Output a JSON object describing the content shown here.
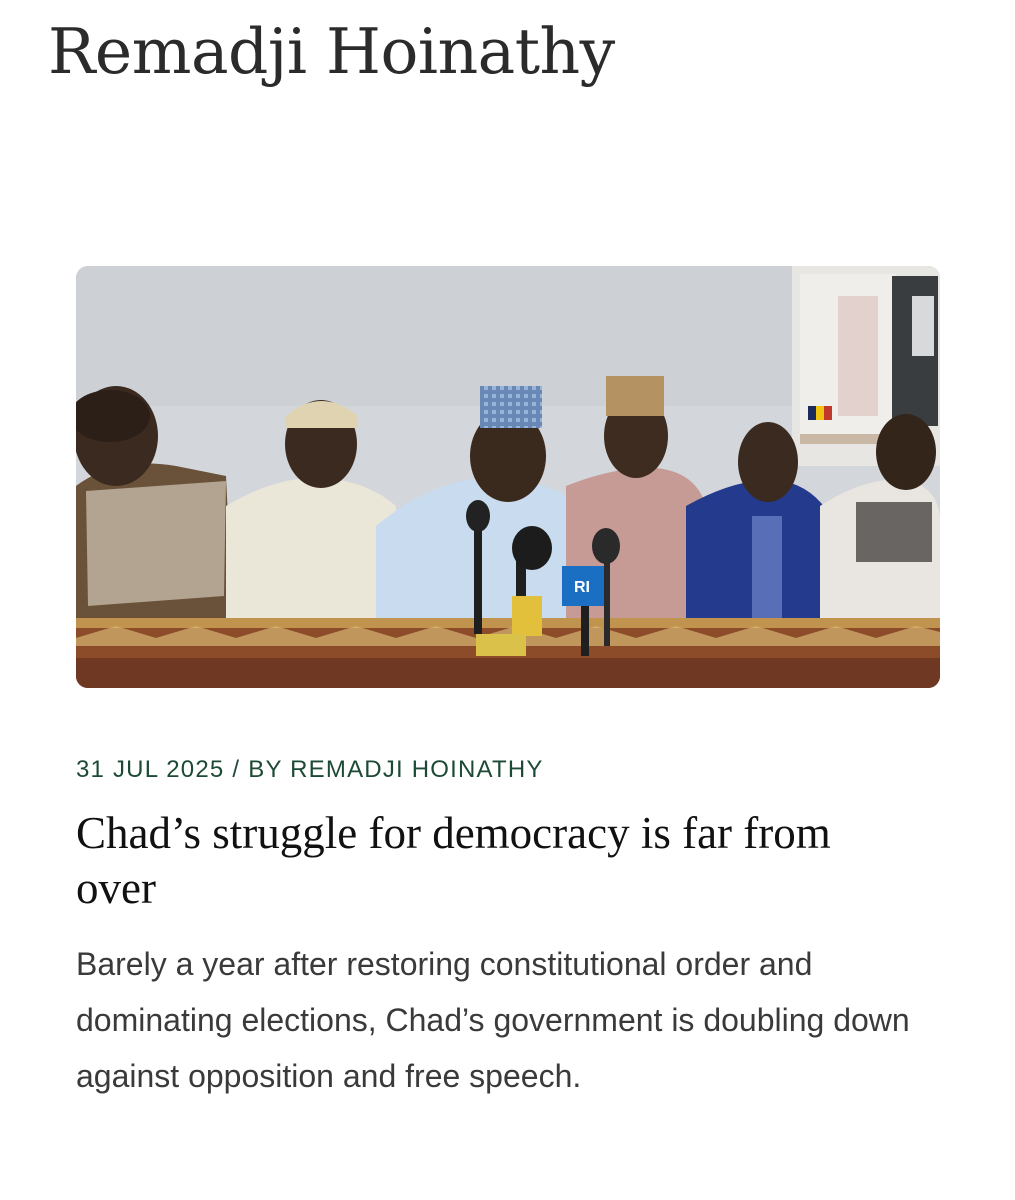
{
  "author": {
    "name": "Remadji Hoinathy"
  },
  "article": {
    "date": "31 JUL 2025",
    "separator": "/",
    "byline": "BY REMADJI HOINATHY",
    "title": "Chad’s struggle for democracy is far from over",
    "excerpt": "Barely a year after restoring constitutional order and dominating elections, Chad’s government is doubling down against opposition and free speech.",
    "image": {
      "microphone_labels": [
        "RI"
      ]
    }
  },
  "colors": {
    "meta_green": "#1d4a35",
    "heading": "#2b2b2b",
    "title": "#111111",
    "excerpt": "#3a3a3a"
  }
}
